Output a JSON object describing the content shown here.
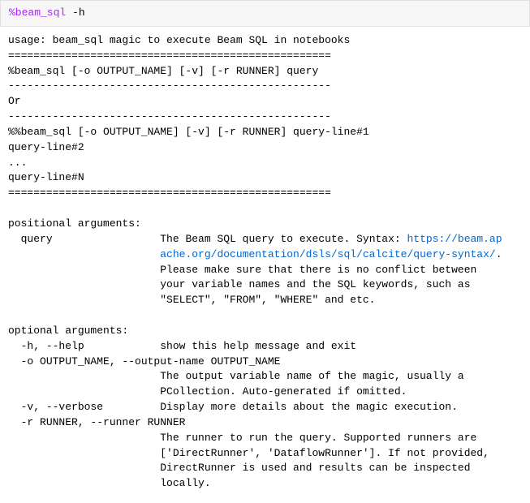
{
  "input": {
    "magic": "%beam_sql",
    "flag": " -h"
  },
  "output": {
    "usage_line": "usage: beam_sql magic to execute Beam SQL in notebooks",
    "sep1": "===================================================",
    "line_single": "%beam_sql [-o OUTPUT_NAME] [-v] [-r RUNNER] query",
    "dash1": "---------------------------------------------------",
    "or": "Or",
    "dash2": "---------------------------------------------------",
    "line_multi1": "%%beam_sql [-o OUTPUT_NAME] [-v] [-r RUNNER] query-line#1",
    "line_multi2": "query-line#2",
    "line_multi3": "...",
    "line_multi4": "query-line#N",
    "sep2": "===================================================",
    "positional_header": "positional arguments:",
    "query_label": "  query                 ",
    "query_desc_1": "The Beam SQL query to execute. Syntax: ",
    "query_link_text": "https://beam.ap",
    "query_link_wrap": "                        ache.org/documentation/dsls/sql/calcite/query-syntax/",
    "query_desc_2": ".\n                        Please make sure that there is no conflict between\n                        your variable names and the SQL keywords, such as\n                        \"SELECT\", \"FROM\", \"WHERE\" and etc.",
    "optional_header": "optional arguments:",
    "h_line": "  -h, --help            show this help message and exit",
    "o_line1": "  -o OUTPUT_NAME, --output-name OUTPUT_NAME",
    "o_line2": "                        The output variable name of the magic, usually a\n                        PCollection. Auto-generated if omitted.",
    "v_line": "  -v, --verbose         Display more details about the magic execution.",
    "r_line1": "  -r RUNNER, --runner RUNNER",
    "r_line2": "                        The runner to run the query. Supported runners are\n                        ['DirectRunner', 'DataflowRunner']. If not provided,\n                        DirectRunner is used and results can be inspected\n                        locally."
  }
}
